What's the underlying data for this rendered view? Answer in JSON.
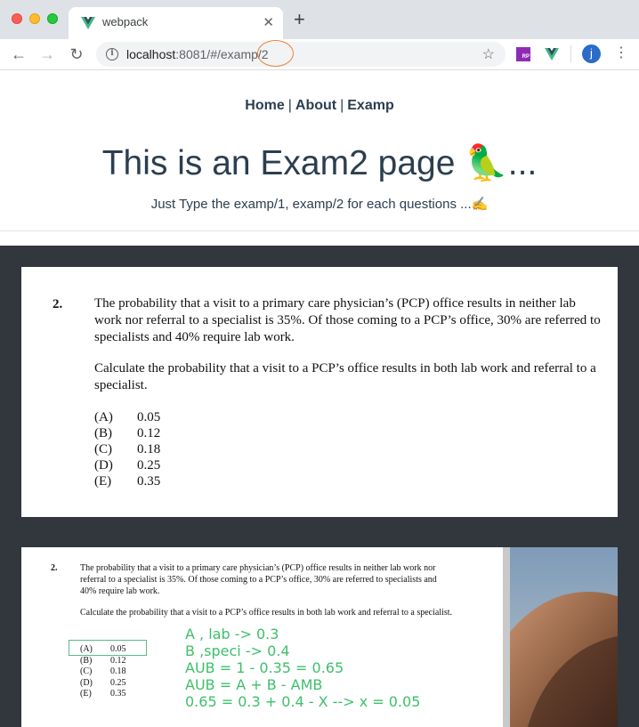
{
  "browser": {
    "tab_title": "webpack",
    "tab_close_icon": "close-icon",
    "new_tab_icon": "plus-icon",
    "url_host": "localhost",
    "url_rest": ":8081/#/examp/2",
    "extensions": [
      "RP",
      "vue-devtools-icon"
    ],
    "profile_initial": "j"
  },
  "nav": {
    "home": "Home",
    "about": "About",
    "examp": "Examp",
    "separator": "|"
  },
  "header": {
    "title": "This is an Exam2 page 🦜...",
    "subtitle": "Just Type the examp/1, examp/2 for each questions ...✍️"
  },
  "question": {
    "number": "2.",
    "paragraph1": "The probability that a visit to a primary care physician’s (PCP) office results in neither lab work nor referral to a specialist is 35%.  Of those coming to a PCP’s office, 30% are referred to specialists and 40% require lab work.",
    "paragraph2": "Calculate the probability that a visit to a PCP’s office results in both lab work and referral to a specialist.",
    "choices": [
      {
        "label": "(A)",
        "value": "0.05"
      },
      {
        "label": "(B)",
        "value": "0.12"
      },
      {
        "label": "(C)",
        "value": "0.18"
      },
      {
        "label": "(D)",
        "value": "0.25"
      },
      {
        "label": "(E)",
        "value": "0.35"
      }
    ]
  },
  "notes": {
    "lines": [
      "A , lab -> 0.3",
      "B ,speci -> 0.4",
      "AUB = 1 - 0.35 = 0.65",
      "AUB =  A + B - AMB",
      "0.65 = 0.3 + 0.4 - X --> x = 0.05"
    ],
    "highlight_color": "#3ec06a"
  }
}
